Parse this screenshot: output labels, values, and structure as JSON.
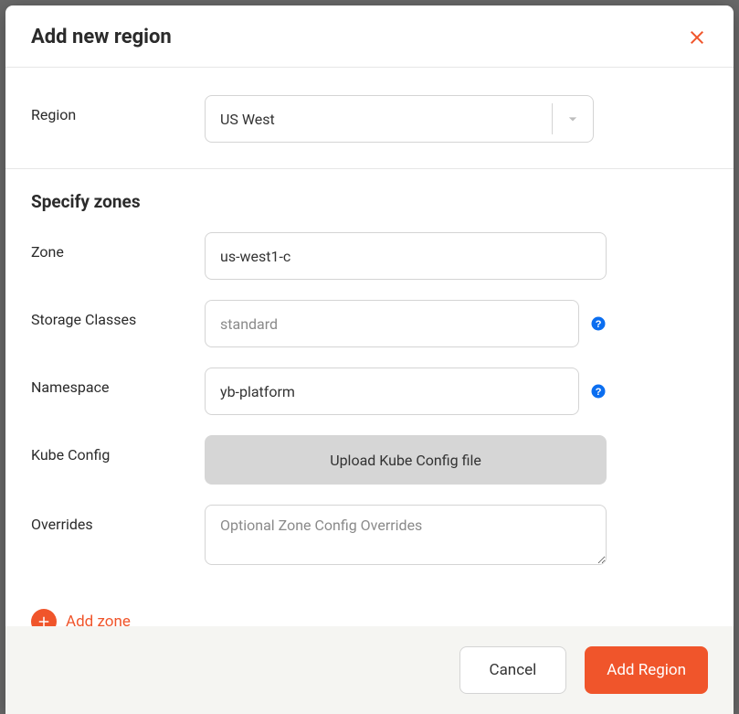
{
  "modal": {
    "title": "Add new region"
  },
  "region": {
    "label": "Region",
    "selected": "US West"
  },
  "zones": {
    "section_title": "Specify zones",
    "zone_label": "Zone",
    "zone_value": "us-west1-c",
    "storage_label": "Storage Classes",
    "storage_placeholder": "standard",
    "storage_value": "",
    "namespace_label": "Namespace",
    "namespace_value": "yb-platform",
    "kubeconfig_label": "Kube Config",
    "kubeconfig_button": "Upload Kube Config file",
    "overrides_label": "Overrides",
    "overrides_placeholder": "Optional Zone Config Overrides",
    "overrides_value": "",
    "add_zone_label": "Add zone"
  },
  "footer": {
    "cancel_label": "Cancel",
    "submit_label": "Add Region"
  },
  "colors": {
    "accent": "#f0552b",
    "help": "#0b6ef0"
  }
}
